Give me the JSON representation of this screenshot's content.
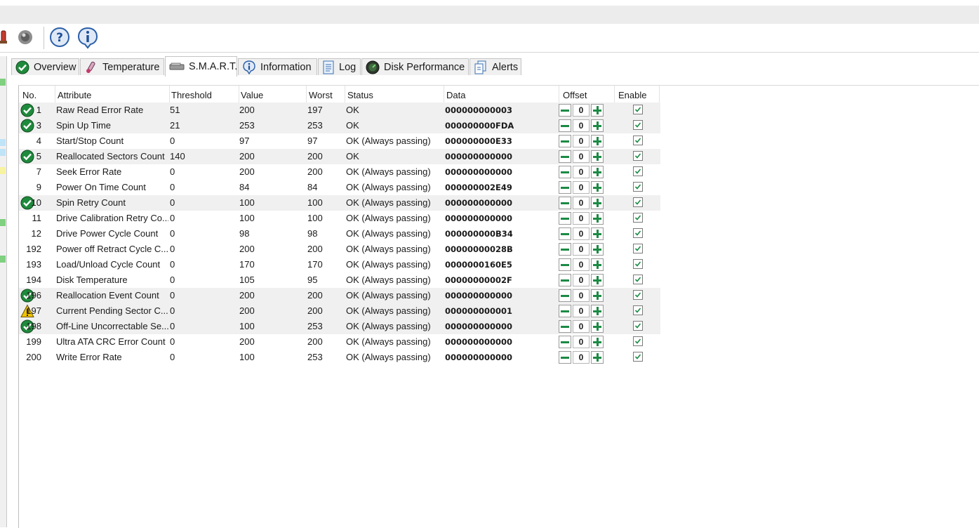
{
  "toolbar": {
    "icons": [
      "thermometer-icon",
      "speaker-icon",
      "help-icon",
      "info-icon"
    ]
  },
  "tabs": [
    {
      "label": "Overview",
      "icon": "check-circle-icon",
      "active": false
    },
    {
      "label": "Temperature",
      "icon": "thermometer-icon",
      "active": false
    },
    {
      "label": "S.M.A.R.T.",
      "icon": "drive-icon",
      "active": true
    },
    {
      "label": "Information",
      "icon": "info-icon",
      "active": false
    },
    {
      "label": "Log",
      "icon": "log-icon",
      "active": false
    },
    {
      "label": "Disk Performance",
      "icon": "gauge-icon",
      "active": false
    },
    {
      "label": "Alerts",
      "icon": "alerts-icon",
      "active": false
    }
  ],
  "table": {
    "headers": [
      "No.",
      "Attribute",
      "Threshold",
      "Value",
      "Worst",
      "Status",
      "Data",
      "Offset",
      "Enable"
    ],
    "rows": [
      {
        "no": "1",
        "attribute": "Raw Read Error Rate",
        "threshold": "51",
        "value": "200",
        "worst": "197",
        "status": "OK",
        "data": "000000000003",
        "offset": "0",
        "enabled": true,
        "icon": "ok",
        "shaded": true
      },
      {
        "no": "3",
        "attribute": "Spin Up Time",
        "threshold": "21",
        "value": "253",
        "worst": "253",
        "status": "OK",
        "data": "000000000FDA",
        "offset": "0",
        "enabled": true,
        "icon": "ok",
        "shaded": true
      },
      {
        "no": "4",
        "attribute": "Start/Stop Count",
        "threshold": "0",
        "value": "97",
        "worst": "97",
        "status": "OK (Always passing)",
        "data": "000000000E33",
        "offset": "0",
        "enabled": true,
        "icon": "",
        "shaded": false
      },
      {
        "no": "5",
        "attribute": "Reallocated Sectors Count",
        "threshold": "140",
        "value": "200",
        "worst": "200",
        "status": "OK",
        "data": "000000000000",
        "offset": "0",
        "enabled": true,
        "icon": "ok",
        "shaded": true
      },
      {
        "no": "7",
        "attribute": "Seek Error Rate",
        "threshold": "0",
        "value": "200",
        "worst": "200",
        "status": "OK (Always passing)",
        "data": "000000000000",
        "offset": "0",
        "enabled": true,
        "icon": "",
        "shaded": false
      },
      {
        "no": "9",
        "attribute": "Power On Time Count",
        "threshold": "0",
        "value": "84",
        "worst": "84",
        "status": "OK (Always passing)",
        "data": "000000002E49",
        "offset": "0",
        "enabled": true,
        "icon": "",
        "shaded": false
      },
      {
        "no": "10",
        "attribute": "Spin Retry Count",
        "threshold": "0",
        "value": "100",
        "worst": "100",
        "status": "OK (Always passing)",
        "data": "000000000000",
        "offset": "0",
        "enabled": true,
        "icon": "ok",
        "shaded": true
      },
      {
        "no": "11",
        "attribute": "Drive Calibration Retry Co...",
        "threshold": "0",
        "value": "100",
        "worst": "100",
        "status": "OK (Always passing)",
        "data": "000000000000",
        "offset": "0",
        "enabled": true,
        "icon": "",
        "shaded": false
      },
      {
        "no": "12",
        "attribute": "Drive Power Cycle Count",
        "threshold": "0",
        "value": "98",
        "worst": "98",
        "status": "OK (Always passing)",
        "data": "000000000B34",
        "offset": "0",
        "enabled": true,
        "icon": "",
        "shaded": false
      },
      {
        "no": "192",
        "attribute": "Power off Retract Cycle C...",
        "threshold": "0",
        "value": "200",
        "worst": "200",
        "status": "OK (Always passing)",
        "data": "00000000028B",
        "offset": "0",
        "enabled": true,
        "icon": "",
        "shaded": false
      },
      {
        "no": "193",
        "attribute": "Load/Unload Cycle Count",
        "threshold": "0",
        "value": "170",
        "worst": "170",
        "status": "OK (Always passing)",
        "data": "0000000160E5",
        "offset": "0",
        "enabled": true,
        "icon": "",
        "shaded": false
      },
      {
        "no": "194",
        "attribute": "Disk Temperature",
        "threshold": "0",
        "value": "105",
        "worst": "95",
        "status": "OK (Always passing)",
        "data": "00000000002F",
        "offset": "0",
        "enabled": true,
        "icon": "",
        "shaded": false
      },
      {
        "no": "196",
        "attribute": "Reallocation Event Count",
        "threshold": "0",
        "value": "200",
        "worst": "200",
        "status": "OK (Always passing)",
        "data": "000000000000",
        "offset": "0",
        "enabled": true,
        "icon": "ok",
        "shaded": true
      },
      {
        "no": "197",
        "attribute": "Current Pending Sector C...",
        "threshold": "0",
        "value": "200",
        "worst": "200",
        "status": "OK (Always passing)",
        "data": "000000000001",
        "offset": "0",
        "enabled": true,
        "icon": "warning",
        "shaded": true
      },
      {
        "no": "198",
        "attribute": "Off-Line Uncorrectable Se...",
        "threshold": "0",
        "value": "100",
        "worst": "253",
        "status": "OK (Always passing)",
        "data": "000000000000",
        "offset": "0",
        "enabled": true,
        "icon": "ok",
        "shaded": true
      },
      {
        "no": "199",
        "attribute": "Ultra ATA CRC Error Count",
        "threshold": "0",
        "value": "200",
        "worst": "200",
        "status": "OK (Always passing)",
        "data": "000000000000",
        "offset": "0",
        "enabled": true,
        "icon": "",
        "shaded": false
      },
      {
        "no": "200",
        "attribute": "Write Error Rate",
        "threshold": "0",
        "value": "100",
        "worst": "253",
        "status": "OK (Always passing)",
        "data": "000000000000",
        "offset": "0",
        "enabled": true,
        "icon": "",
        "shaded": false
      }
    ]
  },
  "colors": {
    "ok_green": "#1f8a3c",
    "warning_yellow": "#f2c200",
    "accent_green": "#1c8a45"
  }
}
